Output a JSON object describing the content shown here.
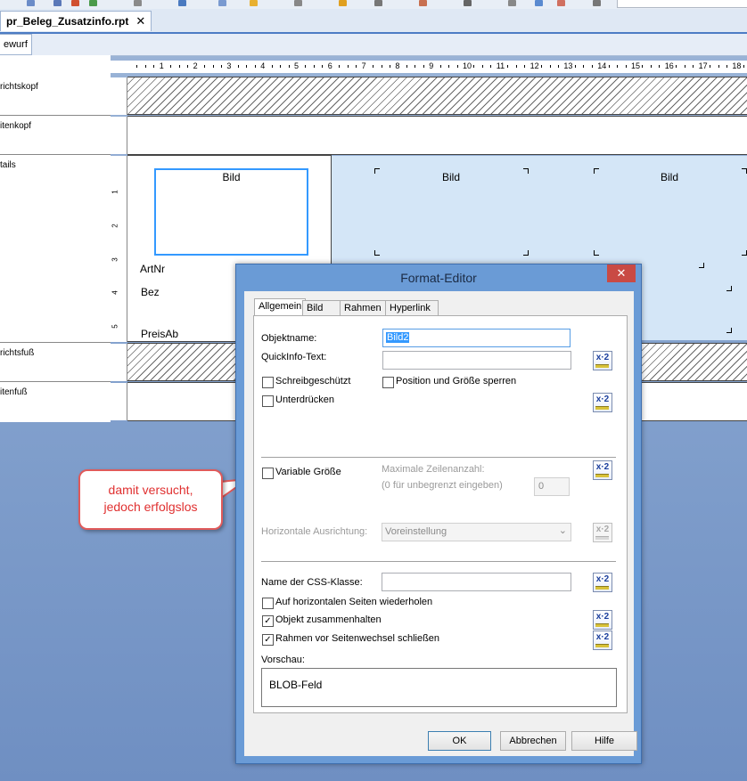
{
  "document": {
    "tab_title": "pr_Beleg_Zusatzinfo.rpt",
    "tab_close": "✕",
    "view_tab": "ewurf"
  },
  "ruler": {
    "numbers": [
      "1",
      "2",
      "3",
      "4",
      "5",
      "6",
      "7",
      "8",
      "9",
      "10",
      "11",
      "12",
      "13",
      "14",
      "15",
      "16",
      "17",
      "18"
    ]
  },
  "sections": [
    {
      "label": "richtskopf"
    },
    {
      "label": "itenkopf"
    },
    {
      "label": "tails"
    },
    {
      "label": "richtsfuß"
    },
    {
      "label": "itenfuß"
    }
  ],
  "vruler_numbers": [
    "1",
    "2",
    "3",
    "4",
    "5"
  ],
  "report_fields": {
    "bild1": "Bild",
    "bild2": "Bild",
    "bild3": "Bild",
    "artnr": "ArtNr",
    "bez": "Bez",
    "preis": "PreisAb"
  },
  "callout": {
    "line1": "damit versucht,",
    "line2": "jedoch erfolgslos"
  },
  "dialog": {
    "title": "Format-Editor",
    "close": "✕",
    "tabs": [
      "Allgemein",
      "Bild",
      "Rahmen",
      "Hyperlink"
    ],
    "objektname_label": "Objektname:",
    "objektname_value": "Bild2",
    "quickinfo_label": "QuickInfo-Text:",
    "quickinfo_value": "",
    "schreibgeschuetzt": "Schreibgeschützt",
    "position_sperren": "Position und Größe sperren",
    "unterdruecken": "Unterdrücken",
    "variable_groesse": "Variable Größe",
    "max_zeilen_label": "Maximale Zeilenanzahl:",
    "max_zeilen_hint": "(0 für unbegrenzt eingeben)",
    "max_zeilen_value": "0",
    "horiz_label": "Horizontale Ausrichtung:",
    "horiz_value": "Voreinstellung",
    "css_label": "Name der CSS-Klasse:",
    "css_value": "",
    "wiederholen": "Auf horizontalen Seiten wiederholen",
    "zusammenhalten": "Objekt zusammenhalten",
    "rahmen_schliessen": "Rahmen vor Seitenwechsel schließen",
    "vorschau_label": "Vorschau:",
    "vorschau_value": "BLOB-Feld",
    "ok": "OK",
    "cancel": "Abbrechen",
    "help": "Hilfe",
    "fx_label": "x·2",
    "check_mark": "✓",
    "dropdown_arrow": "⌄"
  },
  "colors": {
    "accent": "#4c7cc4",
    "callout_border": "#e05a5a",
    "callout_text": "#e03030",
    "dialog_frame": "#6a9bd6",
    "close_button": "#c94a44",
    "selection": "#3399ff"
  }
}
